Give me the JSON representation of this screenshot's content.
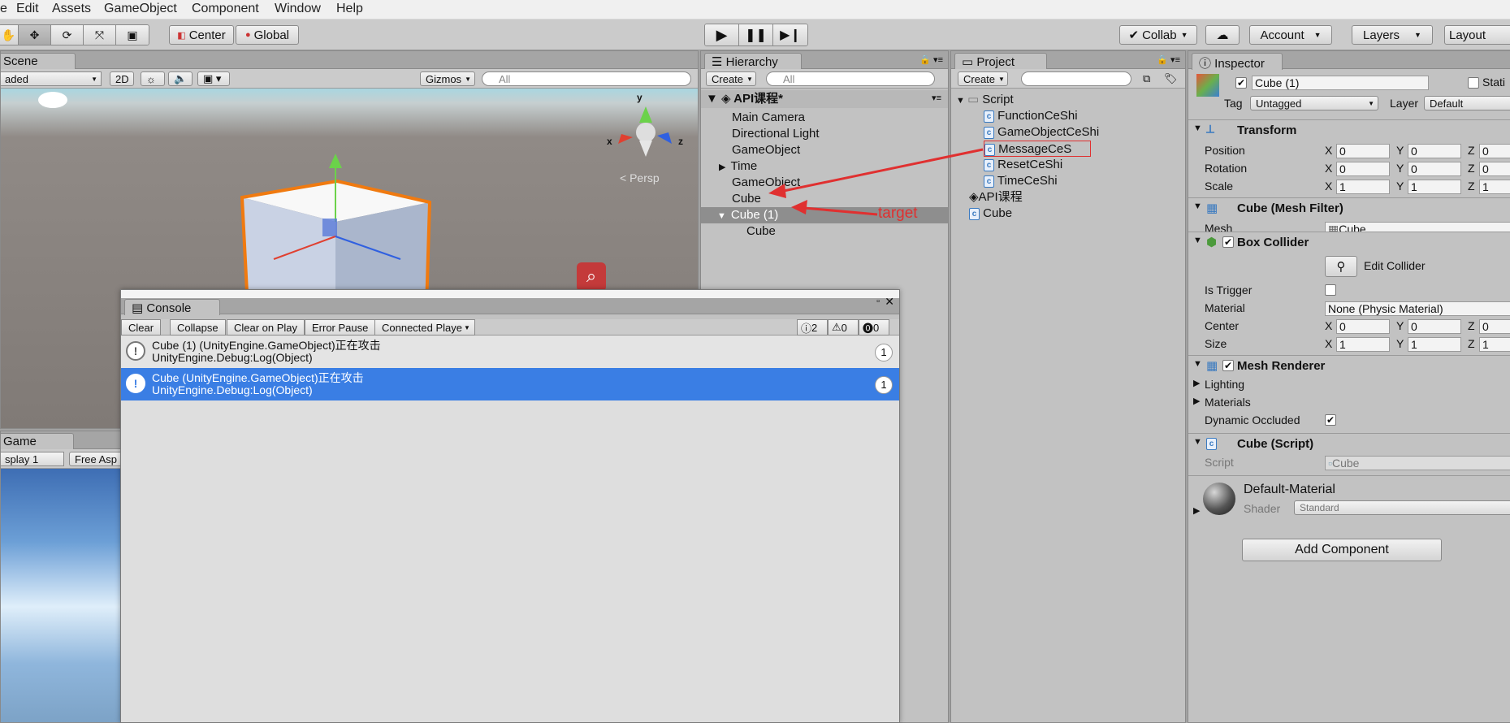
{
  "menubar": {
    "items": [
      "e",
      "Edit",
      "Assets",
      "GameObject",
      "Component",
      "Window",
      "Help"
    ]
  },
  "toolbar": {
    "pivot_label": "Center",
    "space_label": "Global",
    "collab_label": "Collab",
    "account_label": "Account",
    "layers_label": "Layers",
    "layout_label": "Layout"
  },
  "scene": {
    "tab": "Scene",
    "shading": "aded",
    "mode_2d": "2D",
    "gizmos": "Gizmos",
    "search_placeholder": "All",
    "persp": "Persp",
    "axis_x": "x",
    "axis_y": "y",
    "axis_z": "z"
  },
  "game": {
    "tab": "Game",
    "display": "splay 1",
    "aspect": "Free Asp"
  },
  "hierarchy": {
    "tab": "Hierarchy",
    "create": "Create",
    "search_placeholder": "All",
    "scene_name": "API课程*",
    "items": [
      "Main Camera",
      "Directional Light",
      "GameObject",
      "Time",
      "GameObject",
      "Cube",
      "Cube (1)",
      "Cube"
    ],
    "annotation": "target"
  },
  "project": {
    "tab": "Project",
    "create": "Create",
    "items": [
      "Script",
      "FunctionCeShi",
      "GameObjectCeShi",
      "MessageCeS",
      "ResetCeShi",
      "TimeCeShi",
      "API课程",
      "Cube"
    ]
  },
  "console": {
    "tab": "Console",
    "buttons": [
      "Clear",
      "Collapse",
      "Clear on Play",
      "Error Pause",
      "Connected Playe"
    ],
    "counts": {
      "info": "2",
      "warn": "0",
      "error": "0"
    },
    "entries": [
      {
        "line1": "Cube (1) (UnityEngine.GameObject)正在攻击",
        "line2": "UnityEngine.Debug:Log(Object)",
        "count": "1"
      },
      {
        "line1": "Cube (UnityEngine.GameObject)正在攻击",
        "line2": "UnityEngine.Debug:Log(Object)",
        "count": "1"
      }
    ]
  },
  "inspector": {
    "tab": "Inspector",
    "name": "Cube (1)",
    "static": "Stati",
    "tag_label": "Tag",
    "tag_value": "Untagged",
    "layer_label": "Layer",
    "layer_value": "Default",
    "transform": {
      "title": "Transform",
      "rows": [
        {
          "label": "Position",
          "x": "0",
          "y": "0",
          "z": "0"
        },
        {
          "label": "Rotation",
          "x": "0",
          "y": "0",
          "z": "0"
        },
        {
          "label": "Scale",
          "x": "1",
          "y": "1",
          "z": "1"
        }
      ]
    },
    "mesh_filter": {
      "title": "Cube (Mesh Filter)",
      "mesh_label": "Mesh",
      "mesh_value": "Cube"
    },
    "box_collider": {
      "title": "Box Collider",
      "edit": "Edit Collider",
      "is_trigger": "Is Trigger",
      "material_label": "Material",
      "material_value": "None (Physic Material)",
      "center": {
        "label": "Center",
        "x": "0",
        "y": "0",
        "z": "0"
      },
      "size": {
        "label": "Size",
        "x": "1",
        "y": "1",
        "z": "1"
      }
    },
    "mesh_renderer": {
      "title": "Mesh Renderer",
      "lighting": "Lighting",
      "materials": "Materials",
      "dynamic_occluded": "Dynamic Occluded"
    },
    "script": {
      "title": "Cube (Script)",
      "label": "Script",
      "value": "Cube"
    },
    "material": {
      "name": "Default-Material",
      "shader_label": "Shader",
      "shader_value": "Standard"
    },
    "add_component": "Add Component"
  },
  "xyz": {
    "x": "X",
    "y": "Y",
    "z": "Z"
  }
}
